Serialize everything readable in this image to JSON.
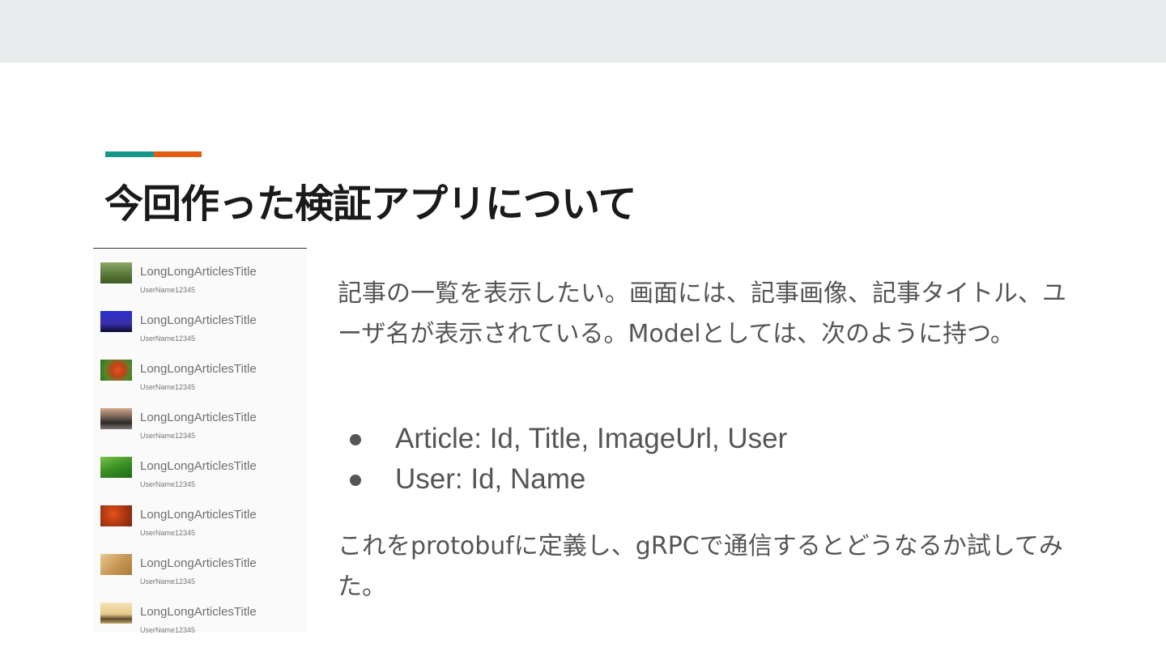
{
  "slide": {
    "title": "今回作った検証アプリについて",
    "para1": "記事の一覧を表示したい。画面には、記事画像、記事タイトル、ユーザ名が表示されている。Modelとしては、次のように持つ。",
    "bullets": [
      "Article: Id, Title, ImageUrl, User",
      "User: Id, Name"
    ],
    "para2": "これをprotobufに定義し、gRPCで通信するとどうなるか試してみた。"
  },
  "accent_colors": {
    "teal": "#17978a",
    "orange": "#e45c14"
  },
  "app_screenshot": {
    "items": [
      {
        "title": "LongLongArticlesTitle",
        "user": "UserName12345",
        "thumb": "field-photo"
      },
      {
        "title": "LongLongArticlesTitle",
        "user": "UserName12345",
        "thumb": "night-sky-photo"
      },
      {
        "title": "LongLongArticlesTitle",
        "user": "UserName12345",
        "thumb": "flower-photo"
      },
      {
        "title": "LongLongArticlesTitle",
        "user": "UserName12345",
        "thumb": "landscape-photo"
      },
      {
        "title": "LongLongArticlesTitle",
        "user": "UserName12345",
        "thumb": "grass-photo"
      },
      {
        "title": "LongLongArticlesTitle",
        "user": "UserName12345",
        "thumb": "autumn-leaves-photo"
      },
      {
        "title": "LongLongArticlesTitle",
        "user": "UserName12345",
        "thumb": "wheat-photo"
      },
      {
        "title": "LongLongArticlesTitle",
        "user": "UserName12345",
        "thumb": "desert-photo"
      }
    ]
  }
}
